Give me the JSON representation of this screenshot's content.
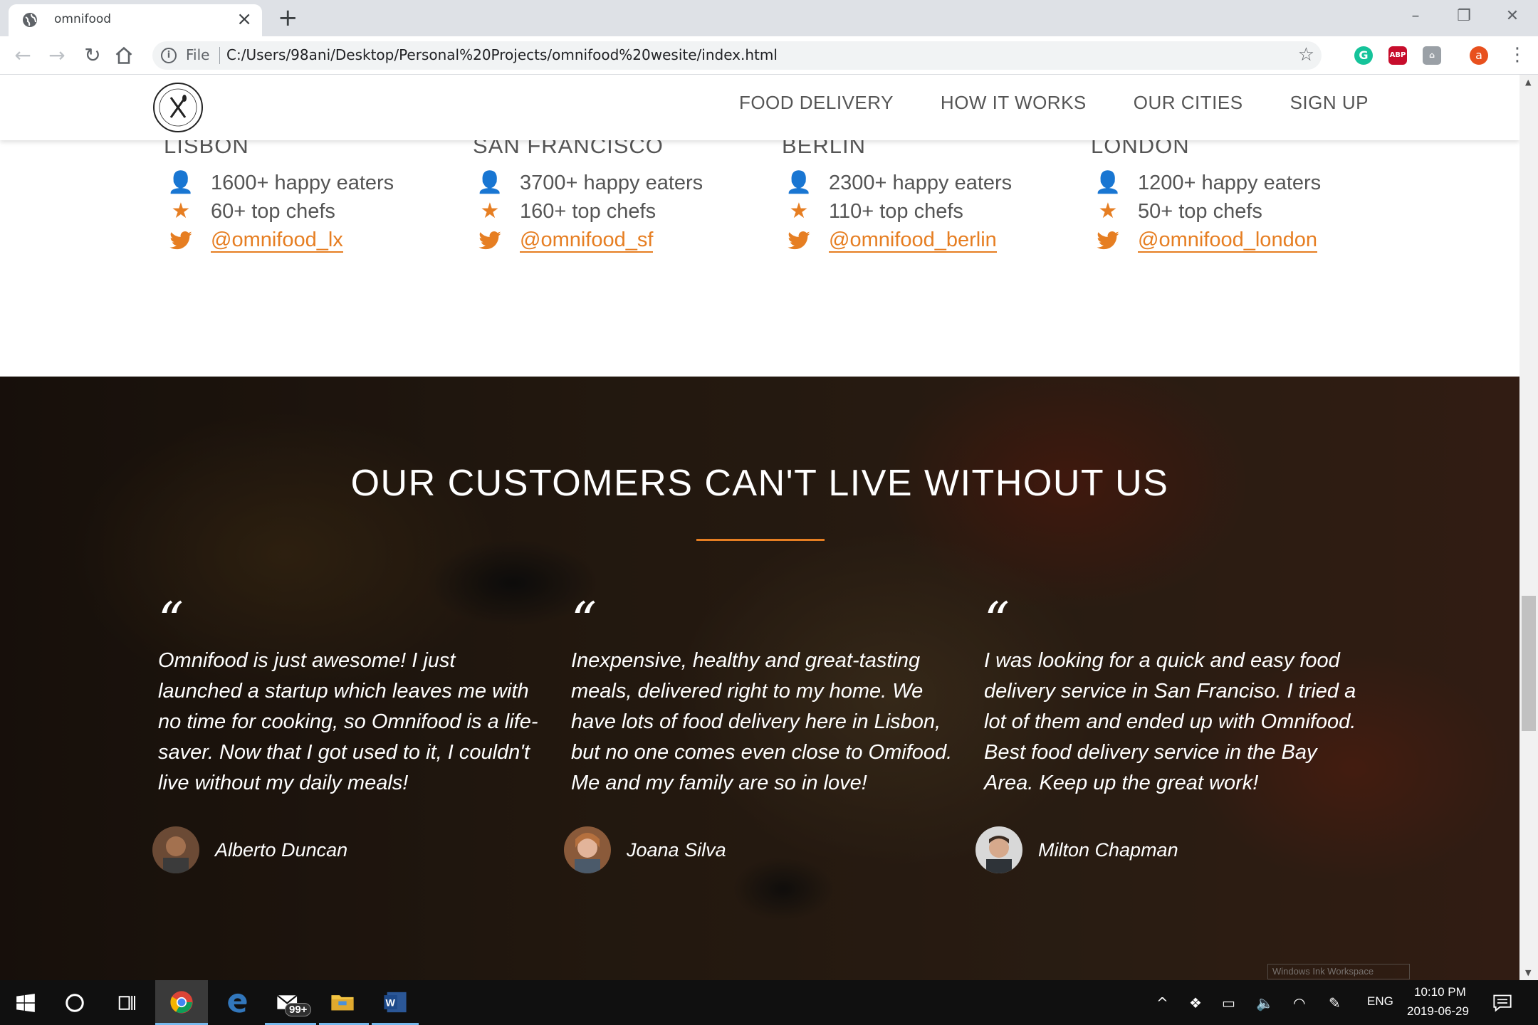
{
  "browser": {
    "tab_title": "omnifood",
    "file_label": "File",
    "url": "C:/Users/98ani/Desktop/Personal%20Projects/omnifood%20wesite/index.html",
    "extensions": [
      "grammarly-icon",
      "adblock-plus-icon",
      "extension-icon",
      "profile-avatar"
    ],
    "profile_initial": "a",
    "abp_label": "ABP"
  },
  "nav": {
    "items": [
      "FOOD DELIVERY",
      "HOW IT WORKS",
      "OUR CITIES",
      "SIGN UP"
    ]
  },
  "cities": [
    {
      "name": "LISBON",
      "eaters": "1600+ happy eaters",
      "chefs": "60+ top chefs",
      "twitter": "@omnifood_lx"
    },
    {
      "name": "SAN FRANCISCO",
      "eaters": "3700+ happy eaters",
      "chefs": "160+ top chefs",
      "twitter": "@omnifood_sf"
    },
    {
      "name": "BERLIN",
      "eaters": "2300+ happy eaters",
      "chefs": "110+ top chefs",
      "twitter": "@omnifood_berlin"
    },
    {
      "name": "LONDON",
      "eaters": "1200+ happy eaters",
      "chefs": "50+ top chefs",
      "twitter": "@omnifood_london"
    }
  ],
  "testimonials": {
    "title": "OUR CUSTOMERS CAN'T LIVE WITHOUT US",
    "quote_mark": "“",
    "items": [
      {
        "text": "Omnifood is just awesome! I just launched a startup which leaves me with no time for cooking, so Omnifood is a life-saver. Now that I got used to it, I couldn't live without my daily meals!",
        "name": "Alberto Duncan"
      },
      {
        "text": "Inexpensive, healthy and great-tasting meals, delivered right to my home. We have lots of food delivery here in Lisbon, but no one comes even close to Omifood. Me and my family are so in love!",
        "name": "Joana Silva"
      },
      {
        "text": "I was looking for a quick and easy food delivery service in San Franciso. I tried a lot of them and ended up with Omnifood. Best food delivery service in the Bay Area. Keep up the great work!",
        "name": "Milton Chapman"
      }
    ]
  },
  "taskbar": {
    "mail_badge": "99+",
    "language": "ENG",
    "time": "10:10 PM",
    "date": "2019-06-29",
    "ink_workspace": "Windows Ink Workspace"
  },
  "colors": {
    "accent": "#e67e22"
  }
}
